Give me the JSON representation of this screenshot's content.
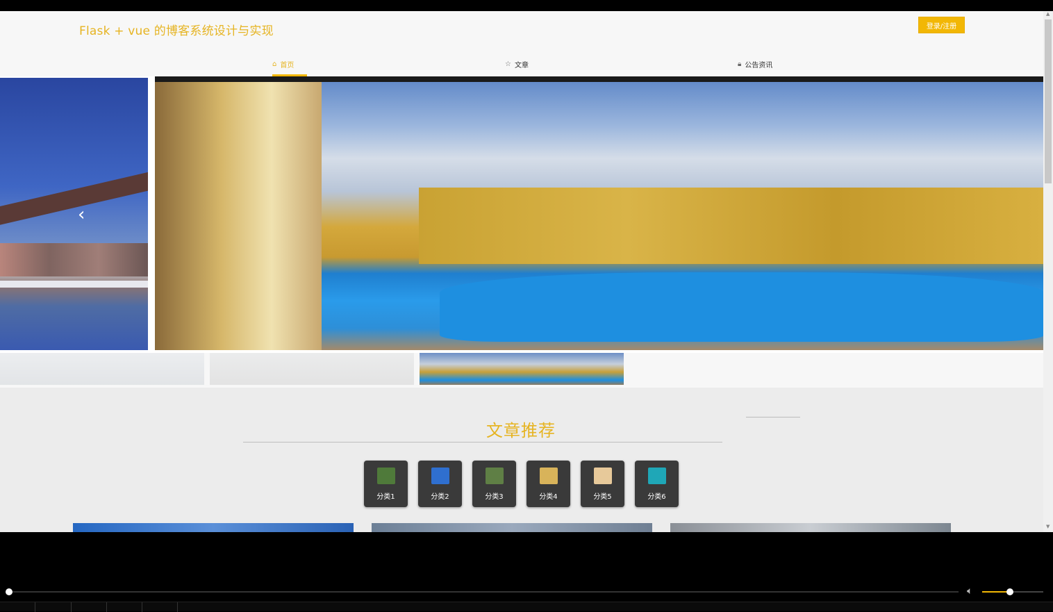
{
  "header": {
    "site_title": "Flask + vue 的博客系统设计与实现",
    "login_label": "登录/注册"
  },
  "nav": {
    "items": [
      {
        "label": "首页",
        "icon": "home-icon",
        "active": true
      },
      {
        "label": "文章",
        "icon": "star-icon",
        "active": false
      },
      {
        "label": "公告资讯",
        "icon": "lock-icon",
        "active": false
      }
    ]
  },
  "carousel": {
    "prev_arrow": "‹",
    "thumb_count": 3,
    "active_thumb": 3
  },
  "section": {
    "title": "文章推荐",
    "categories": [
      {
        "label": "分类1",
        "color": "#4f7a3a"
      },
      {
        "label": "分类2",
        "color": "#2f6fcf"
      },
      {
        "label": "分类3",
        "color": "#5f7f45"
      },
      {
        "label": "分类4",
        "color": "#d8b35a"
      },
      {
        "label": "分类5",
        "color": "#e7c99a"
      },
      {
        "label": "分类6",
        "color": "#1fa7b7"
      }
    ]
  },
  "player": {
    "progress": 0.0,
    "volume": 0.45,
    "volume_icon": "speaker-icon"
  },
  "colors": {
    "accent": "#f2b705",
    "title": "#e6b422"
  }
}
